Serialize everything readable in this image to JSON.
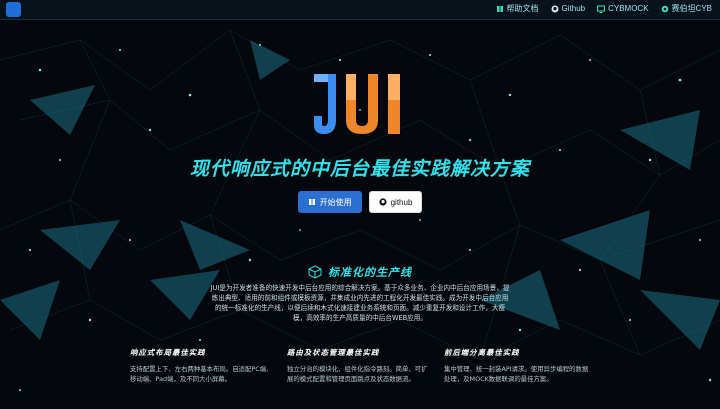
{
  "nav": {
    "items": [
      {
        "label": "帮助文档",
        "icon": "book-icon"
      },
      {
        "label": "Github",
        "icon": "github-icon"
      },
      {
        "label": "CYBMOCK",
        "icon": "monitor-icon"
      },
      {
        "label": "赛伯坦CYB",
        "icon": "globe-icon"
      }
    ]
  },
  "hero": {
    "logo_text": "JUI",
    "headline": "现代响应式的中后台最佳实践解决方案",
    "buttons": {
      "start_label": "开始使用",
      "start_icon": "book-icon",
      "github_label": "github",
      "github_icon": "github-icon"
    }
  },
  "feature": {
    "icon": "cube-icon",
    "title": "标准化的生产线",
    "description": "JUI是为开发者准备的快速开发中后台应用的综合解决方案。基于众多业务、企业内中后台应用场景，提炼出典型、适用的前和组件或模板资源，并集成业内先进的工程化开发最佳实践。成为开发中后台应用的统一标准化的生产线，以便后续和木式化速接建业务系统和页面。减少重复开发和设计工作，大瘦模，高效率的生产高质量的中后台WEB应用。"
  },
  "columns": [
    {
      "title": "响应式布局最佳实践",
      "text": "支持配置上下、左右两种基本布局。自适配PC端、移动端、Pad端，及不同大小屏幕。"
    },
    {
      "title": "路由及状态管理最佳实践",
      "text": "独立分治的模块化、组件化指令路刻。简单、可扩展的模式配置和管理页面跳点及状态数据流。"
    },
    {
      "title": "前后端分离最佳实践",
      "text": "集中管理、统一封装API请求。使用异步编程的数据处理，及MOCK数据联调的最佳方案。"
    }
  ],
  "colors": {
    "accent": "#34e0ea",
    "primary": "#2b6fd1",
    "logo_blue": "#3b8df0",
    "logo_orange": "#f0862a"
  }
}
